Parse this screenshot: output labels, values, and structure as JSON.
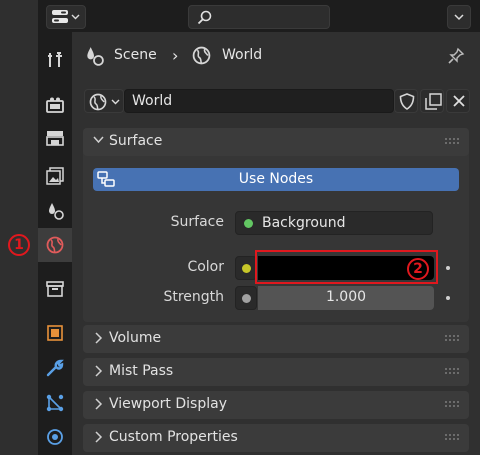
{
  "breadcrumb": {
    "scene_label": "Scene",
    "separator": "›",
    "world_label": "World"
  },
  "datablock": {
    "name": "World"
  },
  "surface_panel": {
    "title": "Surface",
    "use_nodes_label": "Use Nodes",
    "surface_label": "Surface",
    "surface_value": "Background",
    "color_label": "Color",
    "strength_label": "Strength",
    "strength_value": "1.000"
  },
  "collapsed_panels": [
    {
      "title": "Volume"
    },
    {
      "title": "Mist Pass"
    },
    {
      "title": "Viewport Display"
    },
    {
      "title": "Custom Properties"
    }
  ],
  "annotations": {
    "marker_1": "1",
    "marker_2": "2",
    "highlight_color": "#e0181e"
  },
  "colors": {
    "accent_blue": "#4772b3",
    "socket_green": "#63c763",
    "socket_yellow": "#c7c729",
    "socket_gray": "#a1a1a1",
    "world_tab_icon": "#e05b5b"
  },
  "icons": {
    "editor_type": "properties-editor-icon",
    "search": "search-icon",
    "pin": "pin-icon",
    "shield": "fake-user-shield-icon",
    "duplicate": "duplicate-icon",
    "close": "close-icon"
  },
  "tabs": [
    {
      "name": "tool-tab"
    },
    {
      "name": "render-tab"
    },
    {
      "name": "output-tab"
    },
    {
      "name": "view-layer-tab"
    },
    {
      "name": "scene-tab"
    },
    {
      "name": "world-tab",
      "active": true
    },
    {
      "name": "collection-tab"
    },
    {
      "name": "object-tab"
    },
    {
      "name": "modifiers-tab"
    },
    {
      "name": "particles-tab"
    },
    {
      "name": "physics-tab"
    }
  ]
}
